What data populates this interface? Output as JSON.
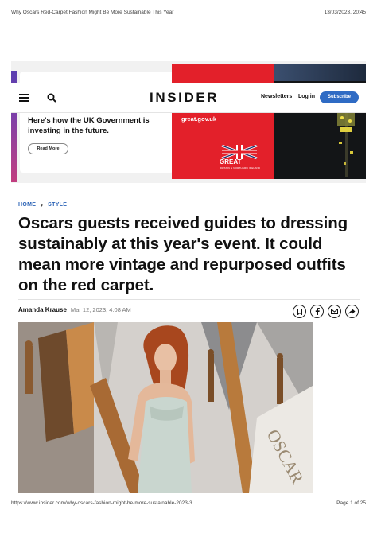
{
  "print": {
    "title": "Why Oscars Red-Carpet Fashion Might Be More Sustainable This Year",
    "datetime": "13/03/2023, 20:45",
    "url": "https://www.insider.com/why-oscars-fashion-might-be-more-sustainable-2023-3",
    "page": "Page 1 of 25"
  },
  "ad": {
    "text": "Here's how the UK Government is investing in the future.",
    "read_more": "Read More",
    "url_text": "great.gov.uk",
    "great_label": "GREAT",
    "great_sub": "BRITAIN & NORTHERN IRELAND"
  },
  "header": {
    "logo": "INSIDER",
    "newsletters": "Newsletters",
    "login": "Log in",
    "subscribe": "Subscribe",
    "icons": [
      "menu-icon",
      "search-icon"
    ]
  },
  "breadcrumb": {
    "home": "HOME",
    "section": "STYLE"
  },
  "article": {
    "headline": "Oscars guests received guides to dressing sustainably at this year's event. It could mean more vintage and repurposed outfits on the red carpet.",
    "author": "Amanda Krause",
    "date": "Mar 12, 2023, 4:08 AM"
  },
  "share_icons": [
    "bookmark-icon",
    "facebook-icon",
    "email-icon",
    "share-icon"
  ],
  "colors": {
    "accent": "#2f6bc4",
    "ad_red": "#e3202a",
    "link": "#2a62b5"
  }
}
